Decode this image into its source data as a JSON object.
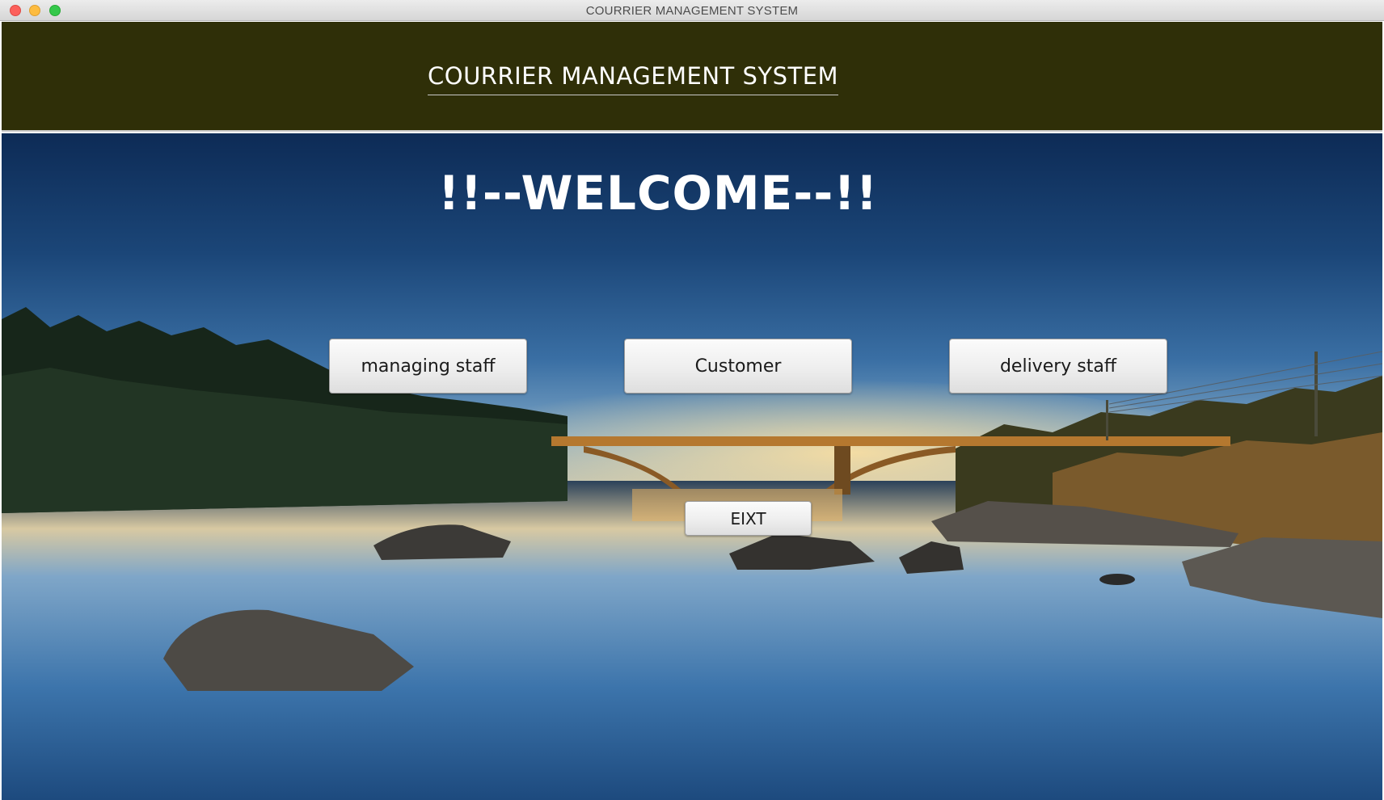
{
  "window": {
    "title": "COURRIER MANAGEMENT SYSTEM"
  },
  "header": {
    "heading": "COURRIER MANAGEMENT SYSTEM",
    "background_color": "#2f2f08"
  },
  "main": {
    "welcome_text": "!!--WELCOME--!!",
    "buttons": {
      "managing_staff": "managing staff",
      "customer": "Customer",
      "delivery_staff": "delivery staff",
      "exit": "EIXT"
    }
  }
}
